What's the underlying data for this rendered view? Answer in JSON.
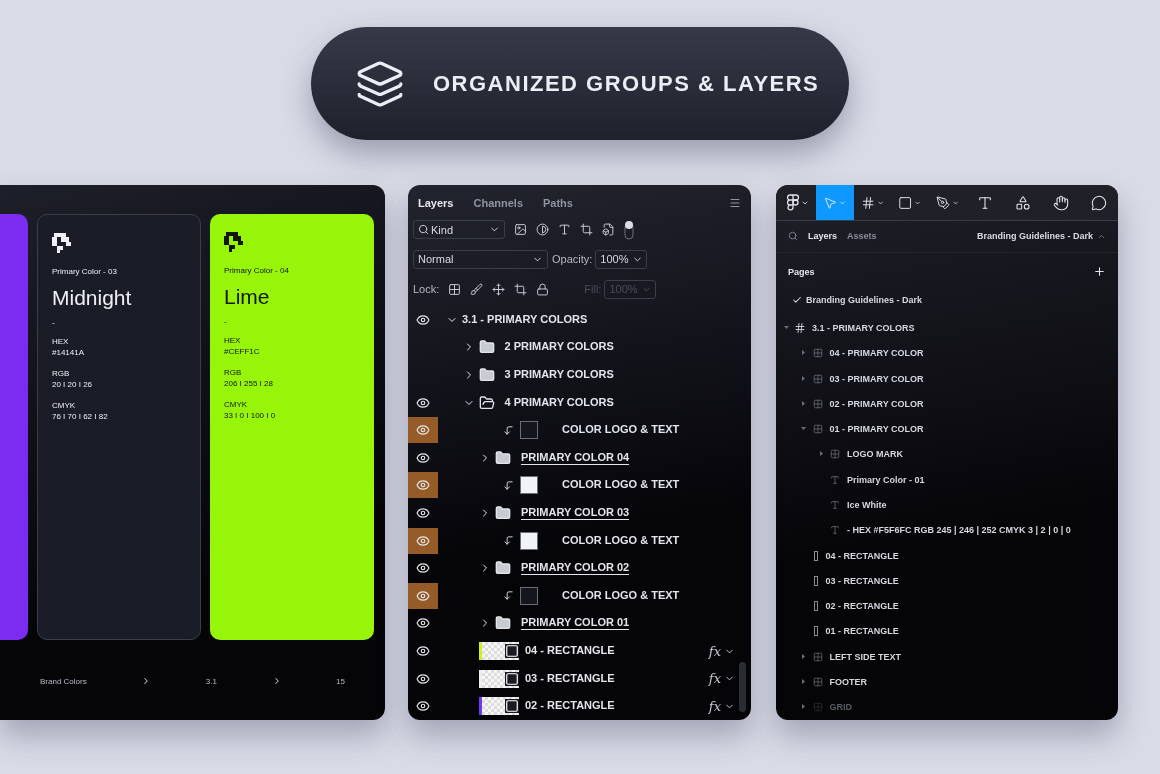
{
  "banner": {
    "title": "ORGANIZED GROUPS & LAYERS"
  },
  "brand_panel": {
    "cards": [
      {
        "color": "#7b2cf0"
      },
      {
        "color": "#1a1c28",
        "label": "Primary Color - 03",
        "name": "Midnight",
        "dash": "-",
        "specs": [
          {
            "key": "HEX",
            "value": "#14141A"
          },
          {
            "key": "RGB",
            "value": "20 I 20 I 26"
          },
          {
            "key": "CMYK",
            "value": "76 I 70 I 62 I 82"
          }
        ]
      },
      {
        "color": "#97f50a",
        "label": "Primary Color - 04",
        "name": "Lime",
        "dash": "-",
        "specs": [
          {
            "key": "HEX",
            "value": "#CEFF1C"
          },
          {
            "key": "RGB",
            "value": "206 I 255 I 28"
          },
          {
            "key": "CMYK",
            "value": "33 I 0 I 100 I 0"
          }
        ]
      }
    ],
    "breadcrumb": [
      "Brand Colors",
      "3.1",
      "15"
    ]
  },
  "layers_panel": {
    "tabs": [
      {
        "label": "Layers",
        "selected": true
      },
      {
        "label": "Channels",
        "selected": false
      },
      {
        "label": "Paths",
        "selected": false
      }
    ],
    "filter": {
      "value": "Kind"
    },
    "blend": {
      "value": "Normal"
    },
    "opacity": {
      "label": "Opacity:",
      "value": "100%"
    },
    "lock": {
      "label": "Lock:"
    },
    "fill": {
      "label": "Fill:",
      "value": "100%",
      "disabled": true
    },
    "layers": [
      {
        "name": "3.1 - PRIMARY COLORS",
        "kind": "root",
        "visible": true,
        "highlighted": false,
        "expanded": true,
        "children": [
          {
            "name": "2 PRIMARY COLORS",
            "kind": "group",
            "visible": false,
            "highlighted": false,
            "expanded": false
          },
          {
            "name": "3 PRIMARY COLORS",
            "kind": "group",
            "visible": false,
            "highlighted": false,
            "expanded": false
          },
          {
            "name": "4 PRIMARY COLORS",
            "kind": "group",
            "visible": true,
            "highlighted": false,
            "expanded": true,
            "children": [
              {
                "name": "COLOR LOGO & TEXT",
                "kind": "clip",
                "visible": true,
                "highlighted": true,
                "color": "#15161c"
              },
              {
                "name": "PRIMARY COLOR 04",
                "kind": "group",
                "visible": true,
                "highlighted": false,
                "expanded": false,
                "linked": true
              },
              {
                "name": "COLOR LOGO & TEXT",
                "kind": "clip",
                "visible": true,
                "highlighted": true,
                "color": "#f2f3f7"
              },
              {
                "name": "PRIMARY COLOR 03",
                "kind": "group",
                "visible": true,
                "highlighted": false,
                "expanded": false,
                "linked": true
              },
              {
                "name": "COLOR LOGO & TEXT",
                "kind": "clip",
                "visible": true,
                "highlighted": true,
                "color": "#f2f3f7"
              },
              {
                "name": "PRIMARY COLOR 02",
                "kind": "group",
                "visible": true,
                "highlighted": false,
                "expanded": false,
                "linked": true
              },
              {
                "name": "COLOR LOGO & TEXT",
                "kind": "clip",
                "visible": true,
                "highlighted": true,
                "color": "#15161c"
              },
              {
                "name": "PRIMARY COLOR 01",
                "kind": "group",
                "visible": true,
                "highlighted": false,
                "expanded": false,
                "linked": true
              },
              {
                "name": "04 - RECTANGLE",
                "kind": "rect",
                "visible": true,
                "highlighted": false,
                "effects": "fx",
                "color": "#cef01c"
              },
              {
                "name": "03 - RECTANGLE",
                "kind": "rect",
                "visible": true,
                "highlighted": false,
                "effects": "fx",
                "color": "#eceef2"
              },
              {
                "name": "02 - RECTANGLE",
                "kind": "rect",
                "visible": true,
                "highlighted": false,
                "effects": "fx",
                "color": "#6b3cf0"
              }
            ]
          }
        ]
      }
    ]
  },
  "design_panel": {
    "tools": [
      {
        "kind": "logo",
        "selected": false,
        "dropdown": true
      },
      {
        "kind": "move",
        "selected": true,
        "dropdown": true
      },
      {
        "kind": "frame",
        "selected": false,
        "dropdown": true
      },
      {
        "kind": "shape",
        "selected": false,
        "dropdown": true
      },
      {
        "kind": "pen",
        "selected": false,
        "dropdown": true
      },
      {
        "kind": "text",
        "selected": false,
        "dropdown": false
      },
      {
        "kind": "components",
        "selected": false,
        "dropdown": false
      },
      {
        "kind": "hand",
        "selected": false,
        "dropdown": false
      },
      {
        "kind": "comment",
        "selected": false,
        "dropdown": false
      }
    ],
    "tabs": [
      {
        "label": "Layers",
        "selected": true
      },
      {
        "label": "Assets",
        "selected": false
      }
    ],
    "page_name": "Branding Guidelines - Dark",
    "pages_heading": "Pages",
    "pages": [
      {
        "name": "Branding Guidelines - Dark",
        "selected": true
      }
    ],
    "layers": [
      {
        "name": "3.1 - PRIMARY COLORS",
        "kind": "frame",
        "expanded": true,
        "hidden": false,
        "children": [
          {
            "name": "04 - PRIMARY COLOR",
            "kind": "group",
            "expanded": false,
            "hidden": false
          },
          {
            "name": "03 - PRIMARY COLOR",
            "kind": "group",
            "expanded": false,
            "hidden": false
          },
          {
            "name": "02 - PRIMARY COLOR",
            "kind": "group",
            "expanded": false,
            "hidden": false
          },
          {
            "name": "01 - PRIMARY COLOR",
            "kind": "group",
            "expanded": true,
            "hidden": false,
            "children": [
              {
                "name": "LOGO MARK",
                "kind": "group",
                "expanded": false,
                "hidden": false
              },
              {
                "name": "Primary Color - 01",
                "kind": "text",
                "hidden": false
              },
              {
                "name": "Ice White",
                "kind": "text",
                "hidden": false
              },
              {
                "name": "- HEX #F5F6FC RGB 245 | 246 | 252 CMYK 3 | 2 | 0 | 0",
                "kind": "text",
                "hidden": false
              }
            ]
          },
          {
            "name": "04 - RECTANGLE",
            "kind": "rect",
            "hidden": false
          },
          {
            "name": "03 - RECTANGLE",
            "kind": "rect",
            "hidden": false
          },
          {
            "name": "02 - RECTANGLE",
            "kind": "rect",
            "hidden": false
          },
          {
            "name": "01 - RECTANGLE",
            "kind": "rect",
            "hidden": false
          },
          {
            "name": "LEFT SIDE TEXT",
            "kind": "group",
            "expanded": false,
            "hidden": false
          },
          {
            "name": "FOOTER",
            "kind": "group",
            "expanded": false,
            "hidden": false
          },
          {
            "name": "GRID",
            "kind": "group",
            "expanded": false,
            "hidden": true
          }
        ]
      }
    ]
  }
}
